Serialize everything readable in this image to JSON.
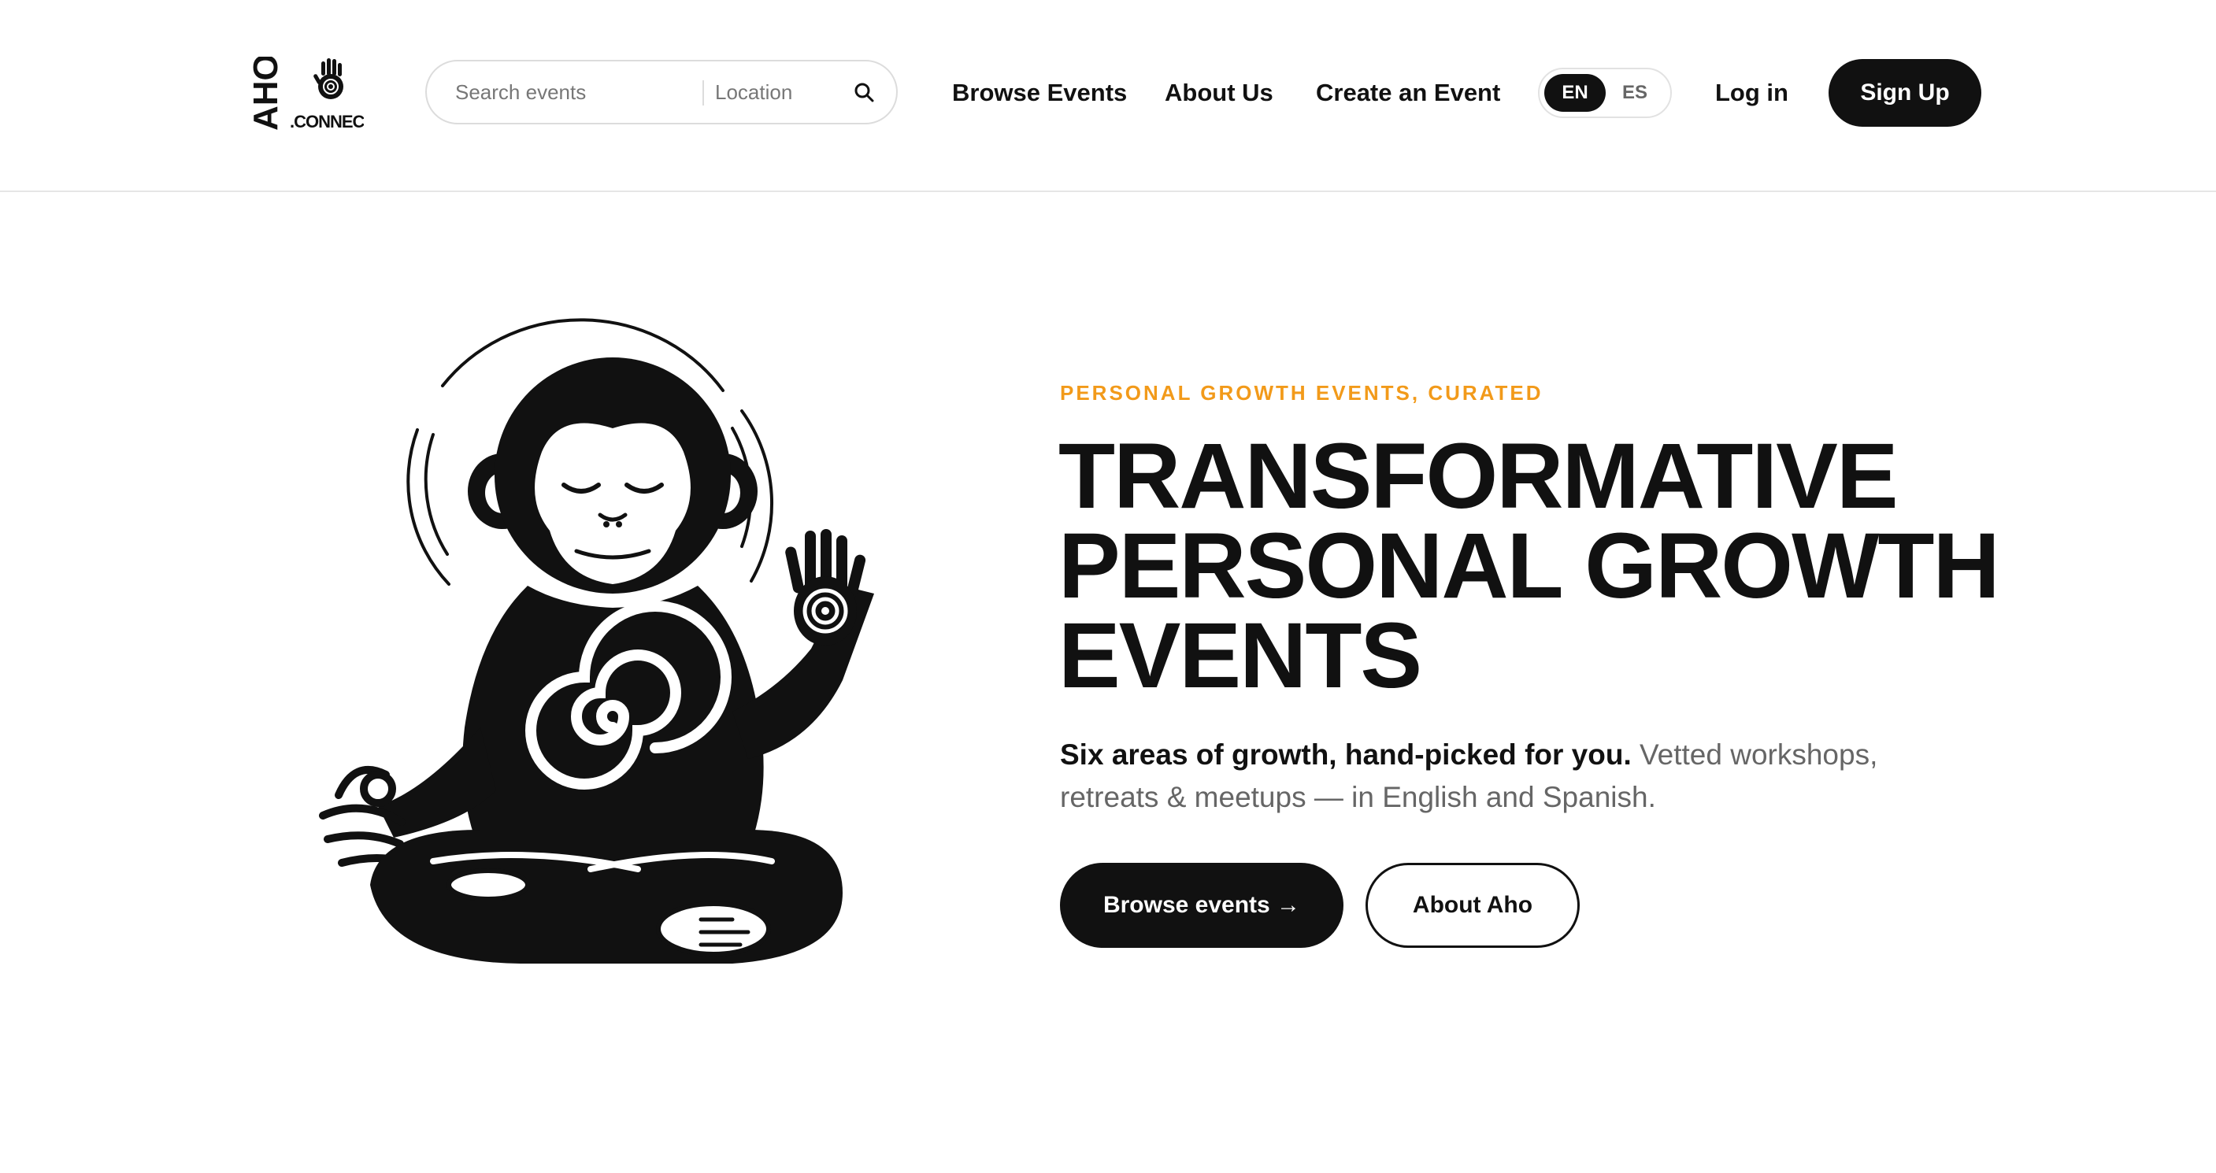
{
  "header": {
    "logo": {
      "wordmark": "AHO",
      "suffix": ".CONNECT"
    },
    "search": {
      "query_placeholder": "Search events",
      "location_placeholder": "Location",
      "button_icon": "search-icon"
    },
    "nav": {
      "browse_label": "Browse Events",
      "about_label": "About Us",
      "create_label": "Create an Event"
    },
    "language": {
      "options": [
        "EN",
        "ES"
      ],
      "selected": "EN"
    },
    "login_label": "Log in",
    "signup_label": "Sign Up"
  },
  "hero": {
    "illustration": "meditating-monkey-illustration",
    "eyebrow": "PERSONAL GROWTH EVENTS, CURATED",
    "headline_lines": [
      "TRANSFORMATIVE",
      "PERSONAL GROWTH",
      "EVENTS"
    ],
    "lede_bold": "Six areas of growth, hand-picked for you.",
    "lede_rest": " Vetted workshops, retreats & meetups — in English and Spanish.",
    "primary_cta": "Browse events →",
    "secondary_cta": "About Aho"
  },
  "colors": {
    "ink": "#111111",
    "accent": "#f29a1a",
    "muted": "#666666",
    "border": "#dcdcdc"
  }
}
